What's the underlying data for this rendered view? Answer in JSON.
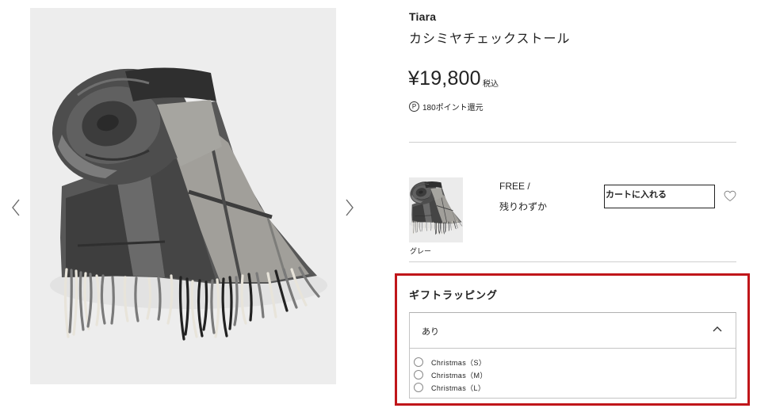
{
  "colors": {
    "text": "#222222",
    "highlight_border": "#c0161a",
    "divider": "#cfcfcf",
    "image_background": "#ededed"
  },
  "gallery": {
    "prev_icon": "chevron-left-icon",
    "next_icon": "chevron-right-icon"
  },
  "product": {
    "brand": "Tiara",
    "name": "カシミヤチェックストール",
    "price": "¥19,800",
    "tax_label": "税込",
    "points_badge": "P",
    "points_text": "180ポイント還元"
  },
  "variant": {
    "color_name": "グレー",
    "size": "FREE /",
    "stock_status": "残りわずか",
    "cart_button_label": "カートに入れる",
    "favorite_icon": "heart-outline-icon"
  },
  "gift_wrapping": {
    "title": "ギフトラッピング",
    "selected": "あり",
    "dropdown_open": true,
    "toggle_icon": "chevron-up-icon",
    "options": [
      {
        "label": "Christmas（S）",
        "checked": false
      },
      {
        "label": "Christmas（M）",
        "checked": false
      },
      {
        "label": "Christmas（L）",
        "checked": false
      }
    ]
  }
}
